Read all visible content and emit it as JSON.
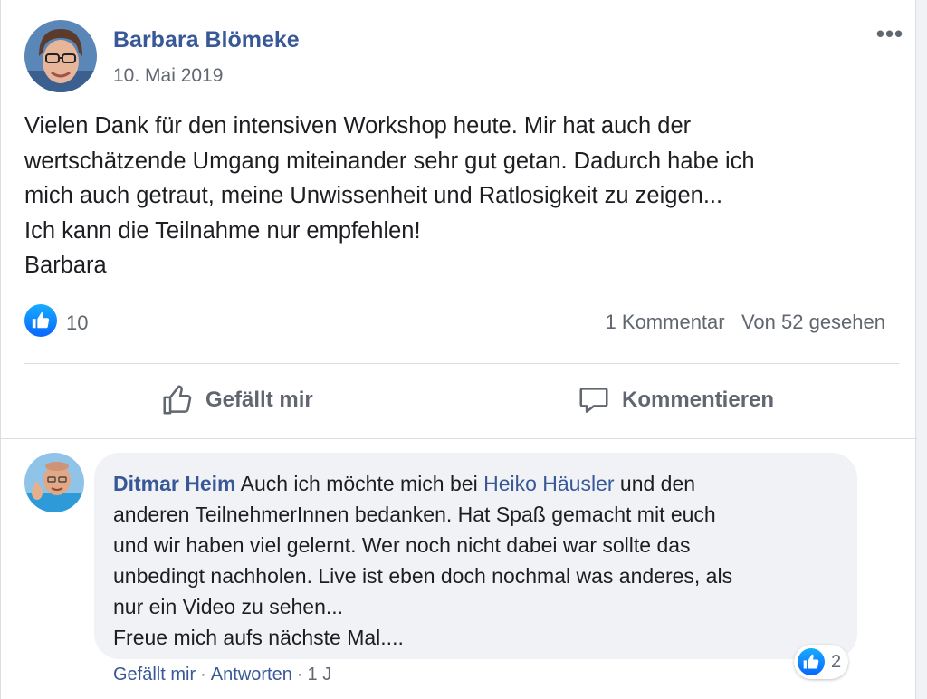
{
  "post": {
    "author": "Barbara Blömeke",
    "date": "10. Mai 2019",
    "more_icon": "more-horizontal-icon",
    "more_label": "•••",
    "text_lines": [
      "Vielen Dank für den intensiven Workshop heute. Mir hat auch der",
      "wertschätzende Umgang miteinander sehr gut getan. Dadurch habe ich",
      "mich auch getraut, meine Unwissenheit und Ratlosigkeit zu zeigen...",
      "Ich kann die Teilnahme nur empfehlen!",
      "Barbara"
    ],
    "like_count": "10",
    "comments_count": "1 Kommentar",
    "seen_count": "Von 52 gesehen"
  },
  "actions": {
    "like_label": "Gefällt mir",
    "comment_label": "Kommentieren"
  },
  "comment": {
    "author": "Ditmar Heim",
    "line1_a": "Auch ich möchte mich bei",
    "mention": "Heiko Häusler",
    "line1_b": "und den",
    "lines": [
      "anderen TeilnehmerInnen bedanken. Hat Spaß gemacht mit euch",
      "und wir haben viel gelernt. Wer noch nicht dabei war sollte das",
      "unbedingt nachholen. Live ist eben doch nochmal was anderes, als",
      "nur ein Video zu sehen...",
      "Freue mich aufs nächste Mal...."
    ],
    "reaction_count": "2",
    "like_link": "Gefällt mir",
    "reply_link": "Antworten",
    "separator": "·",
    "time": "1 J"
  },
  "colors": {
    "link_blue": "#385898",
    "like_blue": "#0866ff",
    "secondary_text": "#606770",
    "bubble_bg": "#f0f2f5"
  }
}
